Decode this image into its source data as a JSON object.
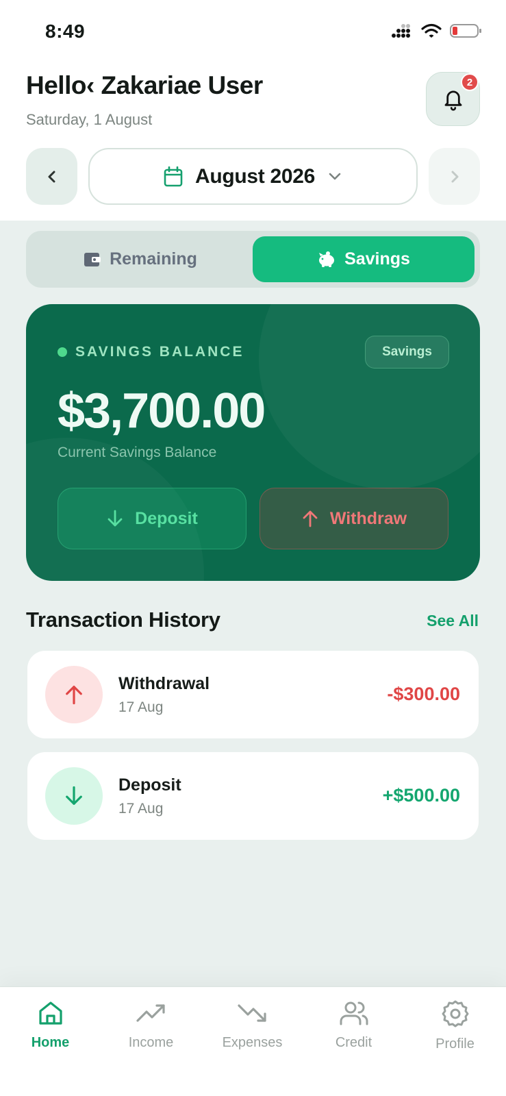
{
  "status_bar": {
    "time": "8:49"
  },
  "header": {
    "greeting": "Hello‹ Zakariae User",
    "date": "Saturday, 1 August",
    "notifications_count": "2"
  },
  "month_selector": {
    "label": "August 2026"
  },
  "segmented": {
    "remaining_label": "Remaining",
    "savings_label": "Savings",
    "active": "Savings"
  },
  "balance_card": {
    "label": "SAVINGS BALANCE",
    "tag": "Savings",
    "amount": "$3,700.00",
    "subtitle": "Current Savings Balance",
    "deposit_label": "Deposit",
    "withdraw_label": "Withdraw"
  },
  "history": {
    "title": "Transaction History",
    "see_all": "See All",
    "items": [
      {
        "name": "Withdrawal",
        "date": "17 Aug",
        "amount": "-$300.00",
        "type": "withdrawal"
      },
      {
        "name": "Deposit",
        "date": "17 Aug",
        "amount": "+$500.00",
        "type": "deposit"
      }
    ]
  },
  "tab_bar": {
    "items": [
      {
        "label": "Home",
        "icon": "home-icon",
        "active": true
      },
      {
        "label": "Income",
        "icon": "trending-up-icon",
        "active": false
      },
      {
        "label": "Expenses",
        "icon": "trending-down-icon",
        "active": false
      },
      {
        "label": "Credit",
        "icon": "users-icon",
        "active": false
      },
      {
        "label": "Profile",
        "icon": "gear-icon",
        "active": false
      }
    ]
  },
  "colors": {
    "accent": "#15bb7f",
    "card": "#0b6a4c",
    "negative": "#e04646",
    "positive": "#14a66f"
  }
}
